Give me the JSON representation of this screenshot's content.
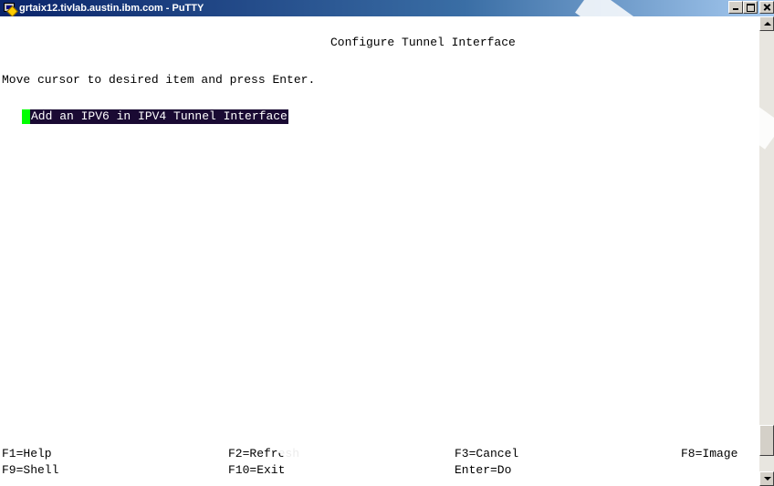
{
  "window": {
    "title": "grtaix12.tivlab.austin.ibm.com - PuTTY",
    "icon": "putty-icon"
  },
  "terminal": {
    "screen_title": "Configure Tunnel Interface",
    "instruction": "Move cursor to desired item and press Enter.",
    "menu_items": [
      {
        "label": "Add an IPV6 in IPV4 Tunnel Interface",
        "selected": true
      }
    ],
    "function_keys_row1": [
      "F1=Help",
      "F2=Refresh",
      "F3=Cancel",
      "F8=Image"
    ],
    "function_keys_row2": [
      "F9=Shell",
      "F10=Exit",
      "Enter=Do"
    ]
  },
  "colors": {
    "selection_bg": "#1a0a33",
    "cursor": "#00ff00",
    "title_gradient_start": "#0a246a"
  }
}
